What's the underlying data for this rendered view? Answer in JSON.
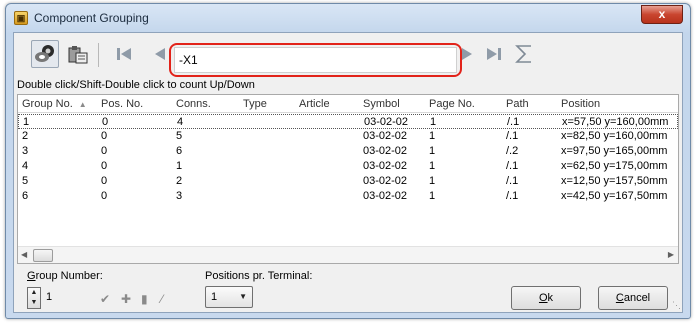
{
  "window": {
    "title": "Component Grouping",
    "close_glyph": "x",
    "icon": "app-logo-icon",
    "icon_glyph": "▣"
  },
  "toolbar": {
    "buttons": [
      {
        "name": "eye-view-icon"
      },
      {
        "name": "clipboard-icon"
      },
      {
        "name": "first-record-icon"
      },
      {
        "name": "previous-record-icon"
      },
      {
        "name": "next-record-icon"
      },
      {
        "name": "last-record-icon"
      },
      {
        "name": "sum-icon"
      }
    ],
    "search_value": "-X1"
  },
  "hint": "Double click/Shift-Double click to count Up/Down",
  "table": {
    "columns": [
      "Group No.",
      "Pos. No.",
      "Conns.",
      "Type",
      "Article",
      "Symbol",
      "Page No.",
      "Path",
      "Position"
    ],
    "rows": [
      [
        "1",
        "0",
        "4",
        "",
        "",
        "03-02-02",
        "1",
        "/.1",
        "x=57,50 y=160,00mm"
      ],
      [
        "2",
        "0",
        "5",
        "",
        "",
        "03-02-02",
        "1",
        "/.1",
        "x=82,50 y=160,00mm"
      ],
      [
        "3",
        "0",
        "6",
        "",
        "",
        "03-02-02",
        "1",
        "/.2",
        "x=97,50 y=165,00mm"
      ],
      [
        "4",
        "0",
        "1",
        "",
        "",
        "03-02-02",
        "1",
        "/.1",
        "x=62,50 y=175,00mm"
      ],
      [
        "5",
        "0",
        "2",
        "",
        "",
        "03-02-02",
        "1",
        "/.1",
        "x=12,50 y=157,50mm"
      ],
      [
        "6",
        "0",
        "3",
        "",
        "",
        "03-02-02",
        "1",
        "/.1",
        "x=42,50 y=167,50mm"
      ]
    ],
    "selected_row": 0
  },
  "bottom": {
    "group_number_label_first": "G",
    "group_number_label_rest": "roup Number:",
    "group_number_value": "1",
    "positions_label": "Positions pr. Terminal:",
    "positions_value": "1",
    "tool_icons": [
      "checkmark-icon",
      "plus-terminal-icon",
      "single-terminal-icon",
      "double-terminal-icon"
    ],
    "ok_first": "O",
    "ok_rest": "k",
    "cancel_first": "C",
    "cancel_rest": "ancel"
  }
}
